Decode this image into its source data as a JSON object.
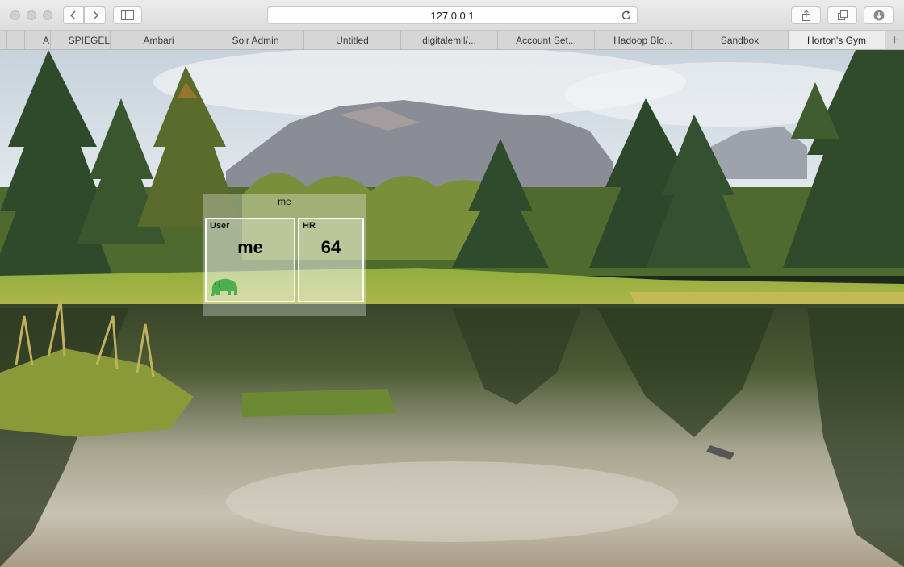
{
  "browser": {
    "url": "127.0.0.1",
    "tabs": [
      {
        "label": "A",
        "active": false
      },
      {
        "label": "SPIEGEL",
        "active": false
      },
      {
        "label": "Ambari",
        "active": false
      },
      {
        "label": "Solr Admin",
        "active": false
      },
      {
        "label": "Untitled",
        "active": false
      },
      {
        "label": "digitalemil/...",
        "active": false
      },
      {
        "label": "Account Set...",
        "active": false
      },
      {
        "label": "Hadoop Blo...",
        "active": false
      },
      {
        "label": "Sandbox",
        "active": false
      },
      {
        "label": "Horton's Gym",
        "active": true
      }
    ],
    "new_tab_glyph": "+"
  },
  "widget": {
    "title": "me",
    "tiles": [
      {
        "label": "User",
        "value": "me",
        "icon": "hortonworks-elephant-icon",
        "icon_color": "#4caf50"
      },
      {
        "label": "HR",
        "value": "64"
      }
    ]
  }
}
